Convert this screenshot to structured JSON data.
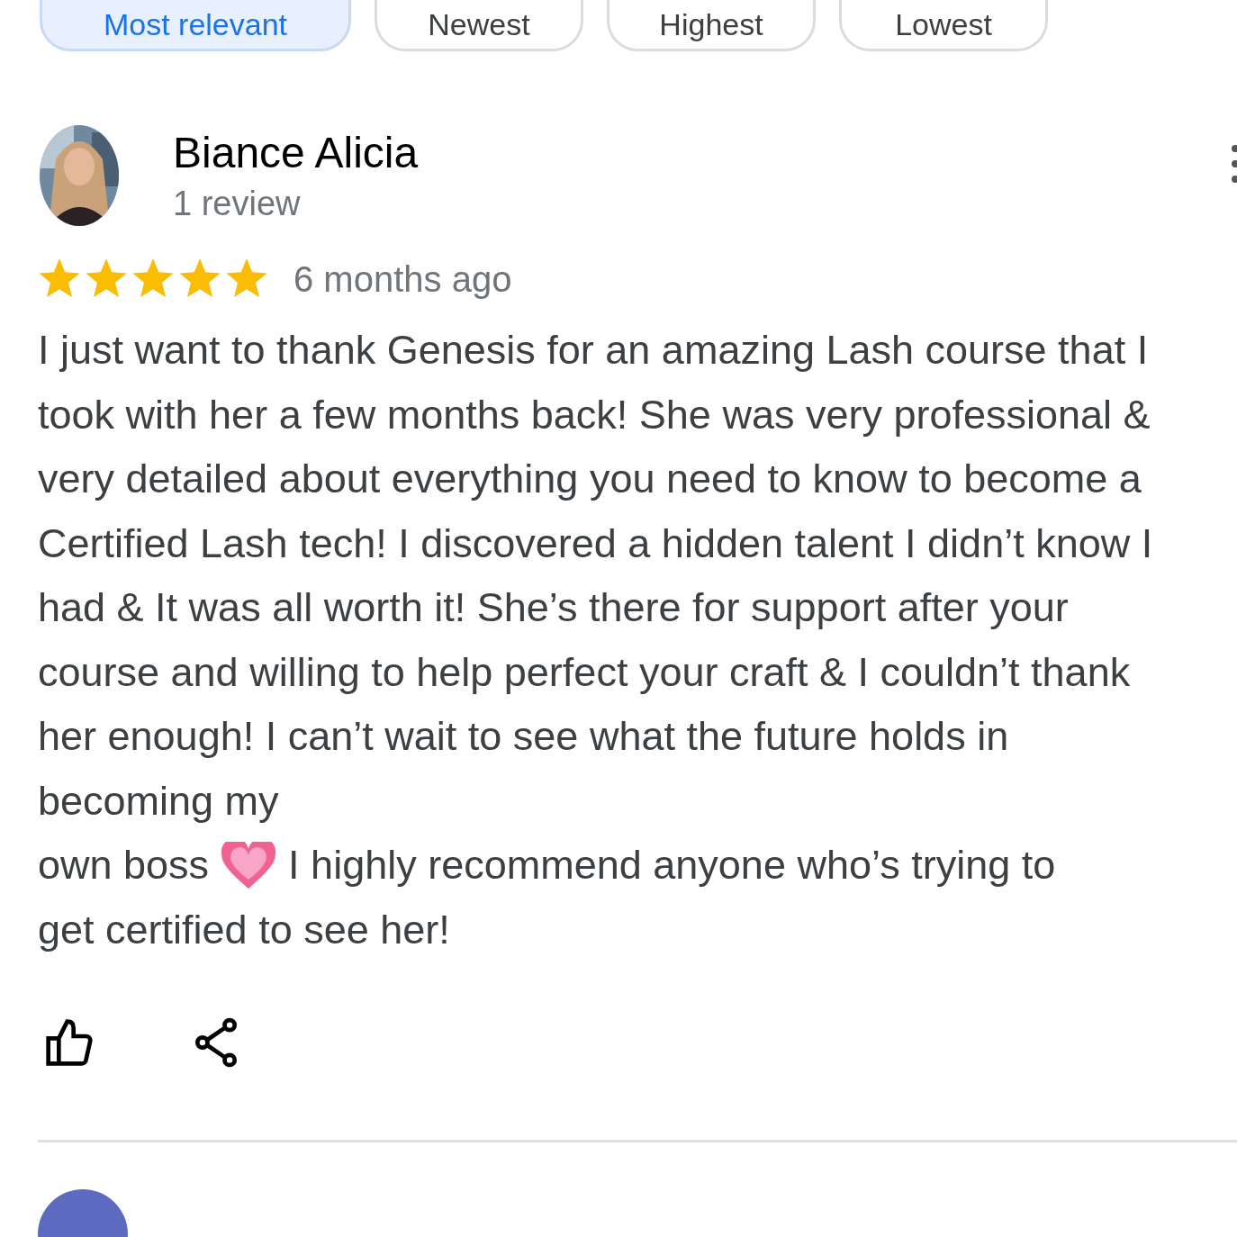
{
  "sort_chips": [
    {
      "label": "Most relevant",
      "selected": true
    },
    {
      "label": "Newest",
      "selected": false
    },
    {
      "label": "Highest",
      "selected": false
    },
    {
      "label": "Lowest",
      "selected": false
    }
  ],
  "reviews": [
    {
      "author": "Biance Alicia",
      "meta": "1 review",
      "stars": 5,
      "date": "6 months ago",
      "text_parts": [
        "I just want to thank Genesis for an amazing Lash course that I took with her a few months back! She was very professional & very detailed about everything you need to know to become a Certified Lash tech! I discovered a hidden talent I didn’t know I had & It was all worth it! She’s there for support after your course and willing to help perfect your craft & I couldn’t thank her enough! I can’t wait to see what the future holds in becoming my",
        "own boss",
        "I highly recommend anyone who’s trying to",
        "get certified to see her!"
      ]
    }
  ]
}
